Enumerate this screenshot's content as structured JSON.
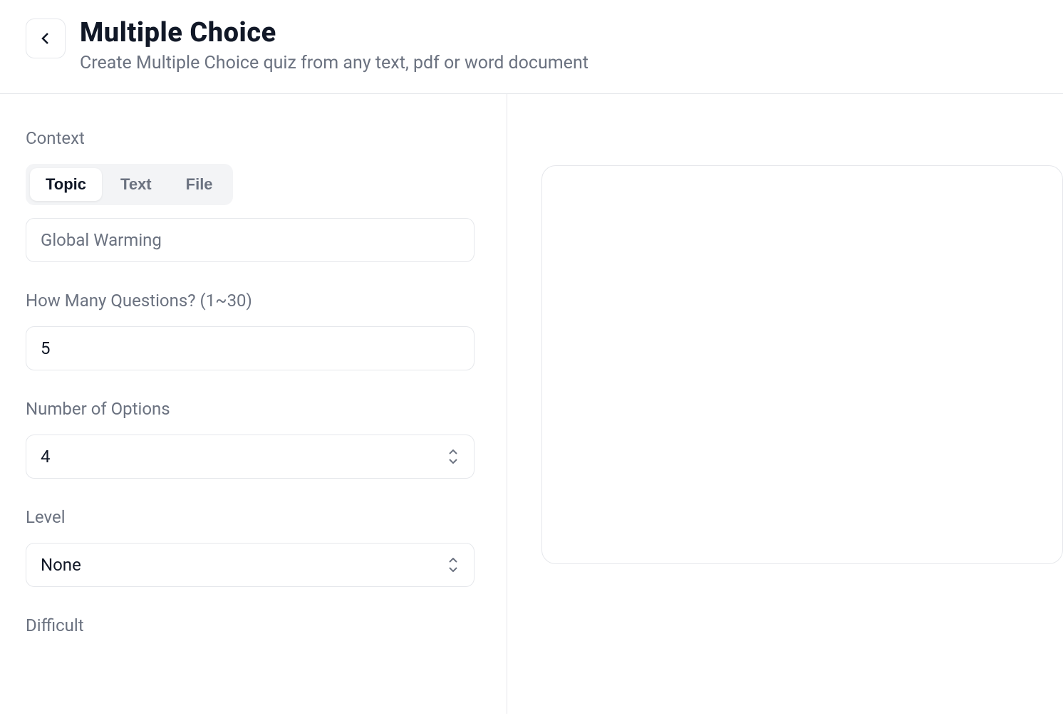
{
  "header": {
    "title": "Multiple Choice",
    "subtitle": "Create Multiple Choice quiz from any text, pdf or word document"
  },
  "form": {
    "context": {
      "label": "Context",
      "tabs": [
        {
          "label": "Topic",
          "active": true
        },
        {
          "label": "Text",
          "active": false
        },
        {
          "label": "File",
          "active": false
        }
      ],
      "topic_placeholder": "Global Warming",
      "topic_value": ""
    },
    "questions": {
      "label": "How Many Questions? (1~30)",
      "value": "5"
    },
    "options": {
      "label": "Number of Options",
      "value": "4"
    },
    "level": {
      "label": "Level",
      "value": "None"
    },
    "difficult": {
      "label": "Difficult"
    }
  }
}
